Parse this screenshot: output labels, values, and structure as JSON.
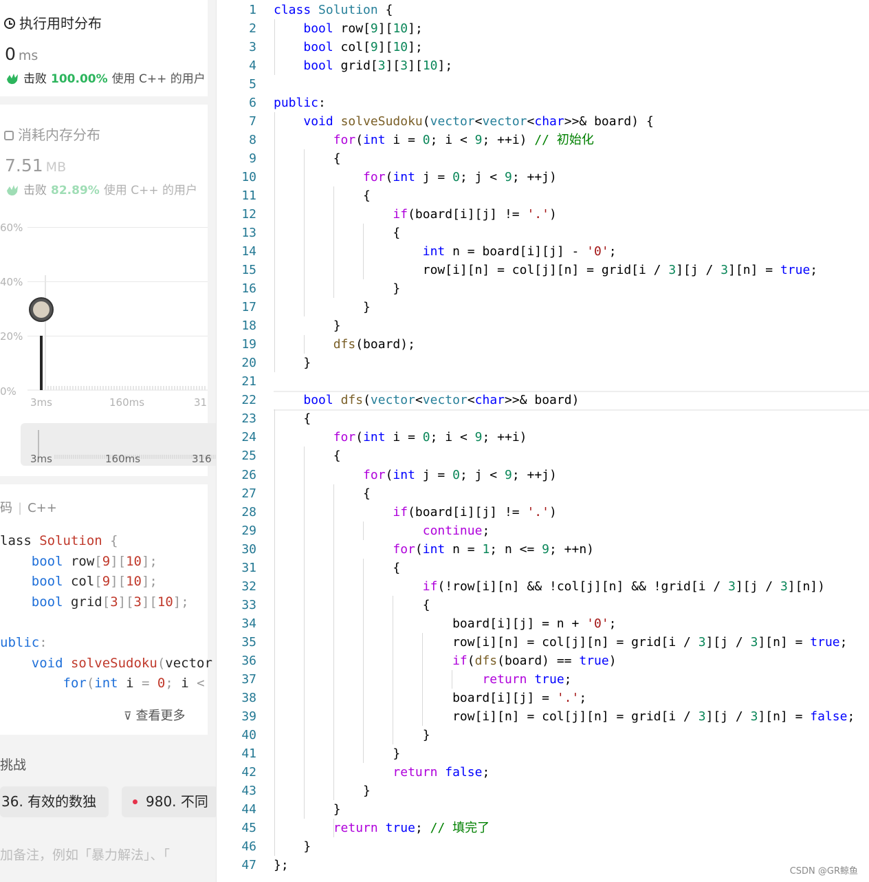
{
  "runtime": {
    "title": "执行用时分布",
    "value": "0",
    "unit": "ms",
    "beats_prefix": "击败",
    "beats_pct": "100.00%",
    "beats_suffix": "使用 C++ 的用户",
    "icon": "clock-icon"
  },
  "memory": {
    "title": "消耗内存分布",
    "value": "7.51",
    "unit": "MB",
    "beats_prefix": "击败",
    "beats_pct": "82.89%",
    "beats_suffix": "使用 C++ 的用户",
    "icon": "chip-icon"
  },
  "chart_data": {
    "type": "bar",
    "y_ticks": [
      "60%",
      "40%",
      "20%",
      "0%"
    ],
    "x_ticks": [
      "3ms",
      "160ms",
      "31"
    ],
    "minimap_x_ticks": [
      "3ms",
      "160ms",
      "316"
    ],
    "highlight_category": "3ms",
    "highlight_value_pct": 20,
    "ylim": [
      0,
      60
    ]
  },
  "code_preview": {
    "tab_label": "码",
    "lang": "C++",
    "lines": [
      "lass Solution {",
      "    bool row[9][10];",
      "    bool col[9][10];",
      "    bool grid[3][3][10];",
      "",
      "ublic:",
      "    void solveSudoku(vector",
      "        for(int i = 0; i <"
    ],
    "more_label": "查看更多"
  },
  "related": {
    "heading": "挑战",
    "chips": [
      "36. 有效的数独",
      "980. 不同"
    ]
  },
  "note_placeholder": "加备注，例如「暴力解法」、「",
  "editor": {
    "watermark": "CSDN @GR鲸鱼"
  }
}
